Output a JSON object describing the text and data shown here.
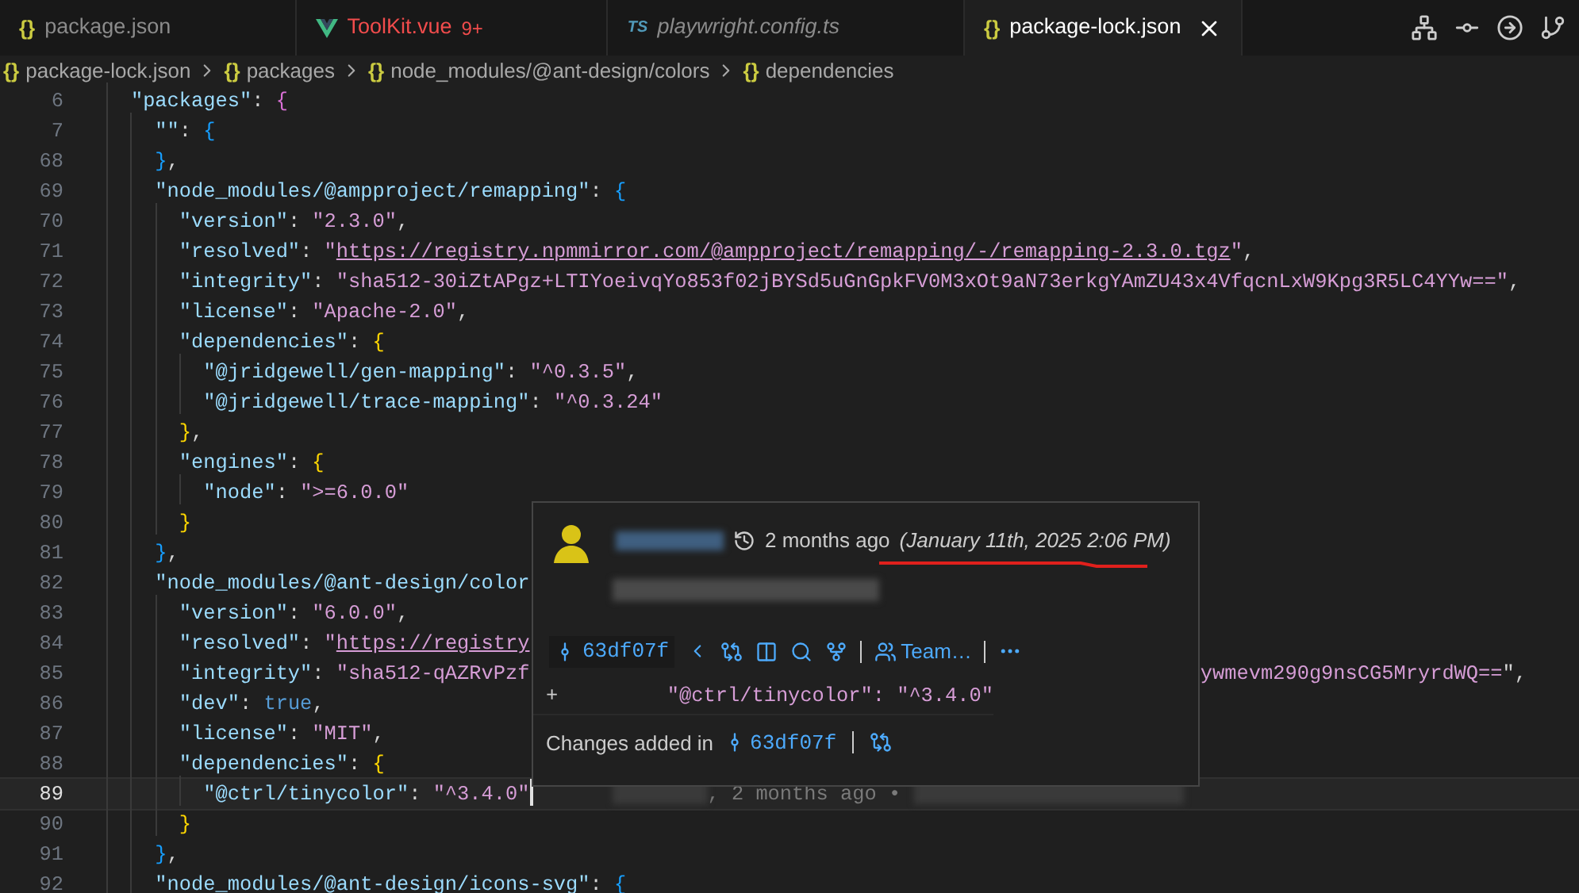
{
  "tabs": [
    {
      "label": "package.json",
      "kind": "json",
      "icon_text": "{}",
      "selected": false,
      "preview": false,
      "error": false
    },
    {
      "label": "ToolKit.vue",
      "kind": "vue",
      "badge": "9+",
      "selected": false,
      "preview": false,
      "error": true
    },
    {
      "label": "playwright.config.ts",
      "kind": "ts",
      "icon_text": "TS",
      "selected": false,
      "preview": true,
      "error": false
    },
    {
      "label": "package-lock.json",
      "kind": "json",
      "icon_text": "{}",
      "selected": true,
      "preview": false,
      "error": false
    }
  ],
  "breadcrumb": [
    {
      "icon_text": "{}",
      "label": "package-lock.json"
    },
    {
      "icon_text": "{}",
      "label": "packages"
    },
    {
      "icon_text": "{}",
      "label": "node_modules/@ant-design/colors"
    },
    {
      "icon_text": "{}",
      "label": "dependencies"
    }
  ],
  "editor": {
    "lines": [
      {
        "number": "6",
        "current": false,
        "tokens": [
          {
            "kind": "key",
            "text": "    \"packages\""
          },
          {
            "kind": "punct",
            "text": ": "
          },
          {
            "kind": "brace",
            "text": "{",
            "color": "#da70d6"
          }
        ]
      },
      {
        "number": "7",
        "current": false,
        "tokens": [
          {
            "kind": "key",
            "text": "      \"\""
          },
          {
            "kind": "punct",
            "text": ": "
          },
          {
            "kind": "brace",
            "text": "{",
            "color": "#179fff"
          }
        ]
      },
      {
        "number": "68",
        "current": false,
        "tokens": [
          {
            "kind": "brace",
            "text": "      }",
            "color": "#179fff"
          },
          {
            "kind": "punct",
            "text": ","
          }
        ]
      },
      {
        "number": "69",
        "current": false,
        "tokens": [
          {
            "kind": "key",
            "text": "      \"node_modules/@ampproject/remapping\""
          },
          {
            "kind": "punct",
            "text": ": "
          },
          {
            "kind": "brace",
            "text": "{",
            "color": "#179fff"
          }
        ]
      },
      {
        "number": "70",
        "current": false,
        "tokens": [
          {
            "kind": "key",
            "text": "        \"version\""
          },
          {
            "kind": "punct",
            "text": ": "
          },
          {
            "kind": "str",
            "text": "\"2.3.0\""
          },
          {
            "kind": "punct",
            "text": ","
          }
        ]
      },
      {
        "number": "71",
        "current": false,
        "tokens": [
          {
            "kind": "key",
            "text": "        \"resolved\""
          },
          {
            "kind": "punct",
            "text": ": "
          },
          {
            "kind": "str",
            "text": "\""
          },
          {
            "kind": "link",
            "text": "https://registry.npmmirror.com/@ampproject/remapping/-/remapping-2.3.0.tgz"
          },
          {
            "kind": "str",
            "text": "\""
          },
          {
            "kind": "punct",
            "text": ","
          }
        ]
      },
      {
        "number": "72",
        "current": false,
        "tokens": [
          {
            "kind": "key",
            "text": "        \"integrity\""
          },
          {
            "kind": "punct",
            "text": ": "
          },
          {
            "kind": "str",
            "text": "\"sha512-30iZtAPgz+LTIYoeivqYo853f02jBYSd5uGnGpkFV0M3xOt9aN73erkgYAmZU43x4VfqcnLxW9Kpg3R5LC4YYw==\""
          },
          {
            "kind": "punct",
            "text": ","
          }
        ]
      },
      {
        "number": "73",
        "current": false,
        "tokens": [
          {
            "kind": "key",
            "text": "        \"license\""
          },
          {
            "kind": "punct",
            "text": ": "
          },
          {
            "kind": "str",
            "text": "\"Apache-2.0\""
          },
          {
            "kind": "punct",
            "text": ","
          }
        ]
      },
      {
        "number": "74",
        "current": false,
        "tokens": [
          {
            "kind": "key",
            "text": "        \"dependencies\""
          },
          {
            "kind": "punct",
            "text": ": "
          },
          {
            "kind": "brace",
            "text": "{",
            "color": "#ffd700"
          }
        ]
      },
      {
        "number": "75",
        "current": false,
        "tokens": [
          {
            "kind": "key",
            "text": "          \"@jridgewell/gen-mapping\""
          },
          {
            "kind": "punct",
            "text": ": "
          },
          {
            "kind": "str",
            "text": "\"^0.3.5\""
          },
          {
            "kind": "punct",
            "text": ","
          }
        ]
      },
      {
        "number": "76",
        "current": false,
        "tokens": [
          {
            "kind": "key",
            "text": "          \"@jridgewell/trace-mapping\""
          },
          {
            "kind": "punct",
            "text": ": "
          },
          {
            "kind": "str",
            "text": "\"^0.3.24\""
          }
        ]
      },
      {
        "number": "77",
        "current": false,
        "tokens": [
          {
            "kind": "brace",
            "text": "        }",
            "color": "#ffd700"
          },
          {
            "kind": "punct",
            "text": ","
          }
        ]
      },
      {
        "number": "78",
        "current": false,
        "tokens": [
          {
            "kind": "key",
            "text": "        \"engines\""
          },
          {
            "kind": "punct",
            "text": ": "
          },
          {
            "kind": "brace",
            "text": "{",
            "color": "#ffd700"
          }
        ]
      },
      {
        "number": "79",
        "current": false,
        "tokens": [
          {
            "kind": "key",
            "text": "          \"node\""
          },
          {
            "kind": "punct",
            "text": ": "
          },
          {
            "kind": "str",
            "text": "\">=6.0.0\""
          }
        ]
      },
      {
        "number": "80",
        "current": false,
        "tokens": [
          {
            "kind": "brace",
            "text": "        }",
            "color": "#ffd700"
          }
        ]
      },
      {
        "number": "81",
        "current": false,
        "tokens": [
          {
            "kind": "brace",
            "text": "      }",
            "color": "#179fff"
          },
          {
            "kind": "punct",
            "text": ","
          }
        ]
      },
      {
        "number": "82",
        "current": false,
        "tokens": [
          {
            "kind": "key",
            "text": "      \"node_modules/@ant-design/color"
          }
        ]
      },
      {
        "number": "83",
        "current": false,
        "tokens": [
          {
            "kind": "key",
            "text": "        \"version\""
          },
          {
            "kind": "punct",
            "text": ": "
          },
          {
            "kind": "str",
            "text": "\"6.0.0\""
          },
          {
            "kind": "punct",
            "text": ","
          }
        ]
      },
      {
        "number": "84",
        "current": false,
        "tokens": [
          {
            "kind": "key",
            "text": "        \"resolved\""
          },
          {
            "kind": "punct",
            "text": ": "
          },
          {
            "kind": "str",
            "text": "\""
          },
          {
            "kind": "link",
            "text": "https://registry"
          }
        ]
      },
      {
        "number": "85",
        "current": false,
        "tokens": [
          {
            "kind": "key",
            "text": "        \"integrity\""
          },
          {
            "kind": "punct",
            "text": ": "
          },
          {
            "kind": "str",
            "text": "\"sha512-qAZRvPzf"
          }
        ],
        "tail": "ywmevm290g9nsCG5MryrdWQ==\","
      },
      {
        "number": "86",
        "current": false,
        "tokens": [
          {
            "kind": "key",
            "text": "        \"dev\""
          },
          {
            "kind": "punct",
            "text": ": "
          },
          {
            "kind": "lit",
            "text": "true"
          },
          {
            "kind": "punct",
            "text": ","
          }
        ]
      },
      {
        "number": "87",
        "current": false,
        "tokens": [
          {
            "kind": "key",
            "text": "        \"license\""
          },
          {
            "kind": "punct",
            "text": ": "
          },
          {
            "kind": "str",
            "text": "\"MIT\""
          },
          {
            "kind": "punct",
            "text": ","
          }
        ]
      },
      {
        "number": "88",
        "current": false,
        "tokens": [
          {
            "kind": "key",
            "text": "        \"dependencies\""
          },
          {
            "kind": "punct",
            "text": ": "
          },
          {
            "kind": "brace",
            "text": "{",
            "color": "#ffd700"
          }
        ]
      },
      {
        "number": "89",
        "current": true,
        "tokens": [
          {
            "kind": "key",
            "text": "          \"@ctrl/tinycolor\""
          },
          {
            "kind": "punct",
            "text": ": "
          },
          {
            "kind": "str",
            "text": "\"^3.4.0\""
          }
        ],
        "blame": ", 2 months ago •"
      },
      {
        "number": "90",
        "current": false,
        "tokens": [
          {
            "kind": "brace",
            "text": "        }",
            "color": "#ffd700"
          }
        ]
      },
      {
        "number": "91",
        "current": false,
        "tokens": [
          {
            "kind": "brace",
            "text": "      }",
            "color": "#179fff"
          },
          {
            "kind": "punct",
            "text": ","
          }
        ]
      },
      {
        "number": "92",
        "current": false,
        "tokens": [
          {
            "kind": "key",
            "text": "      \"node_modules/@ant-design/icons-svg\""
          },
          {
            "kind": "punct",
            "text": ": "
          },
          {
            "kind": "brace",
            "text": "{",
            "color": "#179fff"
          }
        ]
      }
    ]
  },
  "hover": {
    "time_ago": "2 months ago",
    "date": "(January 11th, 2025 2:06 PM)",
    "commit": "63df07f",
    "team": "Team…",
    "diff": {
      "sign": "+",
      "text": "\"@ctrl/tinycolor\": \"^3.4.0\""
    },
    "footer": {
      "label": "Changes added in",
      "commit": "63df07f"
    }
  }
}
